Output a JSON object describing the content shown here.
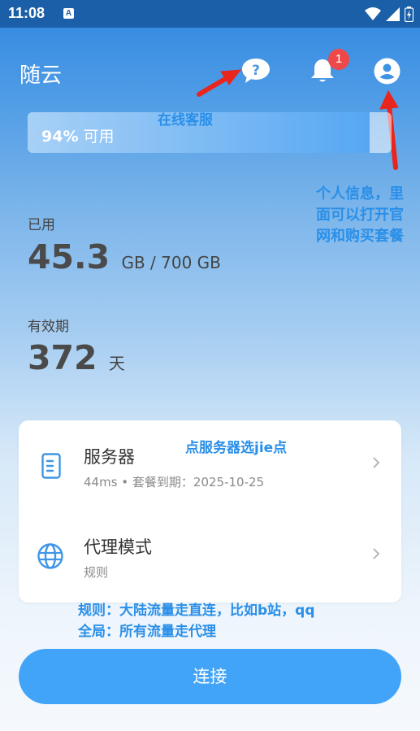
{
  "status_bar": {
    "time": "11:08",
    "notification_glyph": "A"
  },
  "app": {
    "title": "随云",
    "notification_count": "1"
  },
  "usage": {
    "percent": "94%",
    "label": "可用",
    "fill_fraction": 0.94
  },
  "annotations": {
    "customer_service": "在线客服",
    "user_info_line1": "个人信息，里",
    "user_info_line2": "面可以打开官",
    "user_info_line3": "网和购买套餐",
    "server_tip": "点服务器选jie点",
    "mode_tip_line1": "规则：大陆流量走直连，比如b站，qq",
    "mode_tip_line2": "全局：所有流量走代理"
  },
  "used": {
    "label": "已用",
    "value": "45.3",
    "unit": "GB / 700 GB"
  },
  "validity": {
    "label": "有效期",
    "value": "372",
    "unit": "天"
  },
  "server": {
    "title": "服务器",
    "subtitle": "44ms • 套餐到期：2025-10-25"
  },
  "proxy_mode": {
    "title": "代理模式",
    "subtitle": "规则"
  },
  "connect_label": "连接",
  "colors": {
    "accent": "#42a4f8",
    "annotation": "#2a8fe8",
    "arrow": "#e8261e",
    "badge": "#ef4848"
  },
  "icons": [
    "help-icon",
    "bell-icon",
    "user-icon",
    "server-icon",
    "globe-icon",
    "chevron-right-icon",
    "wifi-icon",
    "signal-icon",
    "battery-icon"
  ]
}
